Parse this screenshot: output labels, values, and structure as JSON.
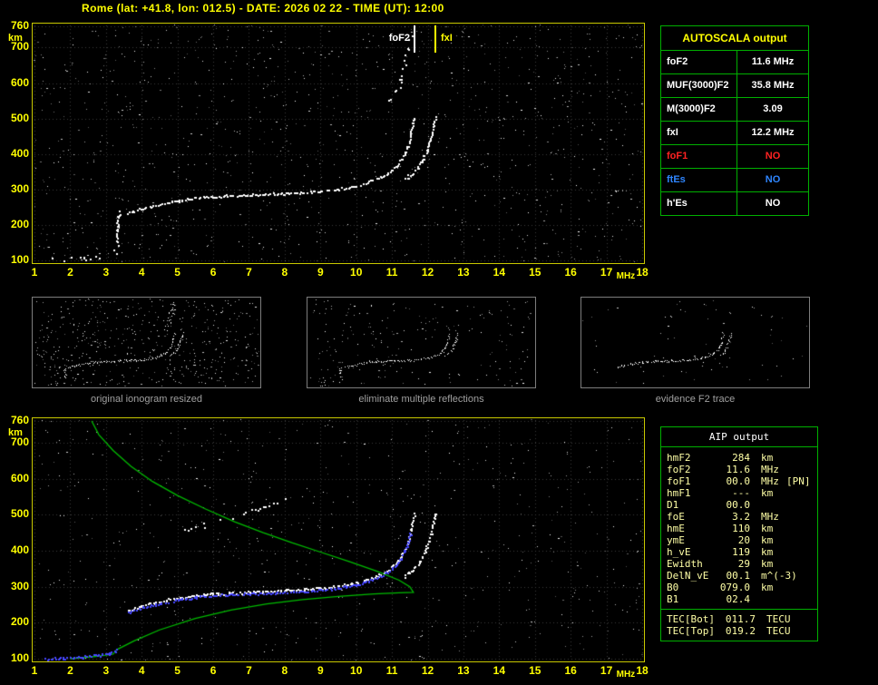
{
  "title": "Rome (lat: +41.8, lon: 012.5) - DATE: 2026 02 22 - TIME (UT): 12:00",
  "colors": {
    "background": "#000000",
    "title": "#ffff00",
    "plot_border": "#c8c800",
    "axis_label": "#ffff00",
    "grid": "#3a3a3a",
    "trace_white": "#ffffff",
    "trace_blue": "#4646ff",
    "profile_green": "#00bb00",
    "table_border": "#00b000",
    "red": "#ff2222",
    "blue": "#2f86ff",
    "aip_text": "#ffffa6",
    "thumb_label": "#a0a0a0"
  },
  "top_plot": {
    "fof2_label": "foF2",
    "fxi_label": "fxI",
    "fof2_mhz": 11.6,
    "fxi_mhz": 12.2
  },
  "thumbnails": [
    {
      "label": "original ionogram resized",
      "noise_dots": 520,
      "traces": [
        "e_region",
        "cusp",
        "f2o",
        "f2x",
        "multiples"
      ]
    },
    {
      "label": "eliminate multiple reflections",
      "noise_dots": 210,
      "traces": [
        "e_region",
        "cusp",
        "f2o",
        "f2x"
      ]
    },
    {
      "label": "evidence F2 trace",
      "noise_dots": 70,
      "traces": [
        "f2o",
        "f2x"
      ]
    }
  ],
  "autoscala_table": {
    "title": "AUTOSCALA output",
    "rows": [
      {
        "label": "foF2",
        "value": "11.6 MHz",
        "color": "white"
      },
      {
        "label": "MUF(3000)F2",
        "value": "35.8 MHz",
        "color": "white"
      },
      {
        "label": "M(3000)F2",
        "value": "3.09",
        "color": "white"
      },
      {
        "label": "fxI",
        "value": "12.2 MHz",
        "color": "white"
      },
      {
        "label": "foF1",
        "value": "NO",
        "color": "red"
      },
      {
        "label": "ftEs",
        "value": "NO",
        "color": "blue"
      },
      {
        "label": "h'Es",
        "value": "NO",
        "color": "white"
      }
    ]
  },
  "aip_table": {
    "title": "AIP output",
    "rows": [
      {
        "label": "hmF2",
        "value": "284",
        "unit": "km",
        "extra": ""
      },
      {
        "label": "foF2",
        "value": "11.6",
        "unit": "MHz",
        "extra": ""
      },
      {
        "label": "foF1",
        "value": "00.0",
        "unit": "MHz",
        "extra": "[PN]"
      },
      {
        "label": "hmF1",
        "value": "---",
        "unit": "km",
        "extra": ""
      },
      {
        "label": "D1",
        "value": "00.0",
        "unit": "",
        "extra": ""
      },
      {
        "label": "foE",
        "value": "3.2",
        "unit": "MHz",
        "extra": ""
      },
      {
        "label": "hmE",
        "value": "110",
        "unit": "km",
        "extra": ""
      },
      {
        "label": "ymE",
        "value": "20",
        "unit": "km",
        "extra": ""
      },
      {
        "label": "h_vE",
        "value": "119",
        "unit": "km",
        "extra": ""
      },
      {
        "label": "Ewidth",
        "value": "29",
        "unit": "km",
        "extra": ""
      },
      {
        "label": "DelN_vE",
        "value": "00.1",
        "unit": "m^(-3)",
        "extra": ""
      },
      {
        "label": "B0",
        "value": "079.0",
        "unit": "km",
        "extra": ""
      },
      {
        "label": "B1",
        "value": "02.4",
        "unit": "",
        "extra": ""
      }
    ],
    "tec_rows": [
      {
        "label": "TEC[Bot]",
        "value": "011.7",
        "unit": "TECU"
      },
      {
        "label": "TEC[Top]",
        "value": "019.2",
        "unit": "TECU"
      }
    ]
  },
  "chart_data": [
    {
      "name": "scaled ionogram with autoscala markers",
      "type": "scatter",
      "xlabel": "MHz",
      "ylabel": "km",
      "xlim": [
        1,
        18
      ],
      "ylim": [
        100,
        760
      ],
      "x_ticks": [
        1,
        2,
        3,
        4,
        5,
        6,
        7,
        8,
        9,
        10,
        11,
        12,
        13,
        14,
        15,
        16,
        17,
        18
      ],
      "y_ticks": [
        760,
        700,
        600,
        500,
        400,
        300,
        200,
        100
      ],
      "grid": true,
      "noise_dots": 1100,
      "annotations": [
        {
          "label": "foF2",
          "x": 11.6,
          "color": "#ffffff"
        },
        {
          "label": "fxI",
          "x": 12.2,
          "color": "#ffff00"
        }
      ],
      "traces": [
        {
          "id": "e_region",
          "name": "E-region echoes",
          "style": "scatter-sparse",
          "color": "#ffffff",
          "points": [
            [
              1.4,
              102
            ],
            [
              1.9,
              104
            ],
            [
              2.4,
              108
            ],
            [
              2.8,
              112
            ],
            [
              3.1,
              118
            ],
            [
              3.25,
              128
            ],
            [
              3.3,
              142
            ]
          ]
        },
        {
          "id": "cusp",
          "name": "E-F cusp",
          "style": "scatter",
          "color": "#ffffff",
          "points": [
            [
              3.28,
              150
            ],
            [
              3.32,
              185
            ],
            [
              3.3,
              215
            ],
            [
              3.38,
              238
            ]
          ]
        },
        {
          "id": "f2o",
          "name": "F2 ordinary trace",
          "style": "scatter",
          "color": "#ffffff",
          "points": [
            [
              3.6,
              235
            ],
            [
              4,
              248
            ],
            [
              4.5,
              260
            ],
            [
              5,
              270
            ],
            [
              5.5,
              277
            ],
            [
              6,
              281
            ],
            [
              6.5,
              284
            ],
            [
              7,
              286
            ],
            [
              7.5,
              288
            ],
            [
              8,
              290
            ],
            [
              8.5,
              293
            ],
            [
              9,
              297
            ],
            [
              9.5,
              303
            ],
            [
              10,
              312
            ],
            [
              10.3,
              320
            ],
            [
              10.6,
              332
            ],
            [
              10.9,
              348
            ],
            [
              11.1,
              365
            ],
            [
              11.25,
              385
            ],
            [
              11.35,
              405
            ],
            [
              11.45,
              430
            ],
            [
              11.52,
              460
            ],
            [
              11.57,
              485
            ],
            [
              11.6,
              505
            ]
          ]
        },
        {
          "id": "f2x",
          "name": "F2 extraordinary trace",
          "style": "scatter",
          "color": "#ffffff",
          "points": [
            [
              11.35,
              330
            ],
            [
              11.55,
              345
            ],
            [
              11.72,
              362
            ],
            [
              11.85,
              385
            ],
            [
              11.95,
              410
            ],
            [
              12.05,
              440
            ],
            [
              12.12,
              465
            ],
            [
              12.18,
              490
            ],
            [
              12.2,
              505
            ]
          ]
        },
        {
          "id": "multiples",
          "name": "multiple reflections",
          "style": "scatter-sparse",
          "color": "#ffffff",
          "points": [
            [
              10.9,
              540
            ],
            [
              11.1,
              575
            ],
            [
              11.25,
              615
            ],
            [
              11.35,
              655
            ],
            [
              11.45,
              700
            ],
            [
              11.5,
              745
            ]
          ]
        }
      ]
    },
    {
      "name": "restored trace with AIP electron density profile",
      "type": "scatter",
      "xlabel": "MHz",
      "ylabel": "km",
      "xlim": [
        1,
        18
      ],
      "ylim": [
        100,
        760
      ],
      "x_ticks": [
        1,
        2,
        3,
        4,
        5,
        6,
        7,
        8,
        9,
        10,
        11,
        12,
        13,
        14,
        15,
        16,
        17,
        18
      ],
      "y_ticks": [
        760,
        700,
        600,
        500,
        400,
        300,
        200,
        100
      ],
      "grid": true,
      "noise_dots": 620,
      "traces": [
        {
          "id": "profile",
          "name": "electron density profile (hmF2 284 km, foF2 11.6 MHz)",
          "style": "line",
          "color": "#00bb00",
          "points": [
            [
              2.0,
              100
            ],
            [
              2.6,
              105
            ],
            [
              3.0,
              110
            ],
            [
              3.2,
              113
            ],
            [
              3.25,
              119
            ],
            [
              3.3,
              125
            ],
            [
              3.8,
              150
            ],
            [
              4.5,
              180
            ],
            [
              5.5,
              212
            ],
            [
              6.5,
              235
            ],
            [
              7.5,
              252
            ],
            [
              8.5,
              264
            ],
            [
              9.5,
              273
            ],
            [
              10.5,
              280
            ],
            [
              11.2,
              283
            ],
            [
              11.6,
              284
            ],
            [
              11.5,
              300
            ],
            [
              11.2,
              318
            ],
            [
              10.6,
              342
            ],
            [
              9.8,
              370
            ],
            [
              9.0,
              396
            ],
            [
              8.2,
              422
            ],
            [
              7.4,
              450
            ],
            [
              6.6,
              480
            ],
            [
              5.8,
              515
            ],
            [
              5.0,
              553
            ],
            [
              4.3,
              592
            ],
            [
              3.7,
              634
            ],
            [
              3.2,
              678
            ],
            [
              2.8,
              722
            ],
            [
              2.6,
              760
            ]
          ]
        },
        {
          "id": "white_f",
          "name": "restored F2 ordinary trace",
          "style": "scatter",
          "color": "#ffffff",
          "points": [
            [
              3.6,
              235
            ],
            [
              4,
              248
            ],
            [
              4.5,
              260
            ],
            [
              5,
              270
            ],
            [
              5.5,
              277
            ],
            [
              6,
              281
            ],
            [
              6.5,
              284
            ],
            [
              7,
              286
            ],
            [
              7.5,
              288
            ],
            [
              8,
              290
            ],
            [
              8.5,
              293
            ],
            [
              9,
              297
            ],
            [
              9.5,
              303
            ],
            [
              10,
              312
            ],
            [
              10.3,
              320
            ],
            [
              10.6,
              332
            ],
            [
              10.9,
              348
            ],
            [
              11.1,
              365
            ],
            [
              11.25,
              385
            ],
            [
              11.35,
              405
            ],
            [
              11.45,
              430
            ],
            [
              11.52,
              460
            ],
            [
              11.57,
              485
            ],
            [
              11.6,
              505
            ]
          ]
        },
        {
          "id": "white_x",
          "name": "restored F2 extraordinary trace",
          "style": "scatter",
          "color": "#ffffff",
          "points": [
            [
              11.35,
              330
            ],
            [
              11.55,
              345
            ],
            [
              11.72,
              362
            ],
            [
              11.85,
              385
            ],
            [
              11.95,
              410
            ],
            [
              12.05,
              440
            ],
            [
              12.12,
              465
            ],
            [
              12.18,
              490
            ],
            [
              12.2,
              505
            ]
          ]
        },
        {
          "id": "multiples",
          "name": "residual second reflections",
          "style": "scatter-sparse",
          "color": "#ffffff",
          "points": [
            [
              5.2,
              455
            ],
            [
              6.0,
              480
            ],
            [
              6.8,
              505
            ],
            [
              7.5,
              528
            ],
            [
              8.0,
              545
            ]
          ]
        },
        {
          "id": "blue_e",
          "name": "scaled E-region points",
          "style": "scatter",
          "color": "#4646ff",
          "points": [
            [
              1.3,
              100
            ],
            [
              1.8,
              103
            ],
            [
              2.3,
              106
            ],
            [
              2.8,
              111
            ],
            [
              3.1,
              116
            ],
            [
              3.3,
              124
            ]
          ]
        },
        {
          "id": "blue_f",
          "name": "scaled F-trace points",
          "style": "scatter",
          "color": "#4646ff",
          "points": [
            [
              3.6,
              230
            ],
            [
              4,
              243
            ],
            [
              4.5,
              255
            ],
            [
              5,
              265
            ],
            [
              5.5,
              272
            ],
            [
              6,
              276
            ],
            [
              6.5,
              279
            ],
            [
              7,
              281
            ],
            [
              7.5,
              283
            ],
            [
              8,
              285
            ],
            [
              8.5,
              288
            ],
            [
              9,
              292
            ],
            [
              9.5,
              298
            ],
            [
              10,
              307
            ],
            [
              10.3,
              315
            ],
            [
              10.6,
              327
            ],
            [
              10.9,
              343
            ],
            [
              11.1,
              360
            ],
            [
              11.25,
              380
            ],
            [
              11.35,
              400
            ],
            [
              11.45,
              425
            ],
            [
              11.5,
              450
            ]
          ]
        }
      ]
    }
  ]
}
